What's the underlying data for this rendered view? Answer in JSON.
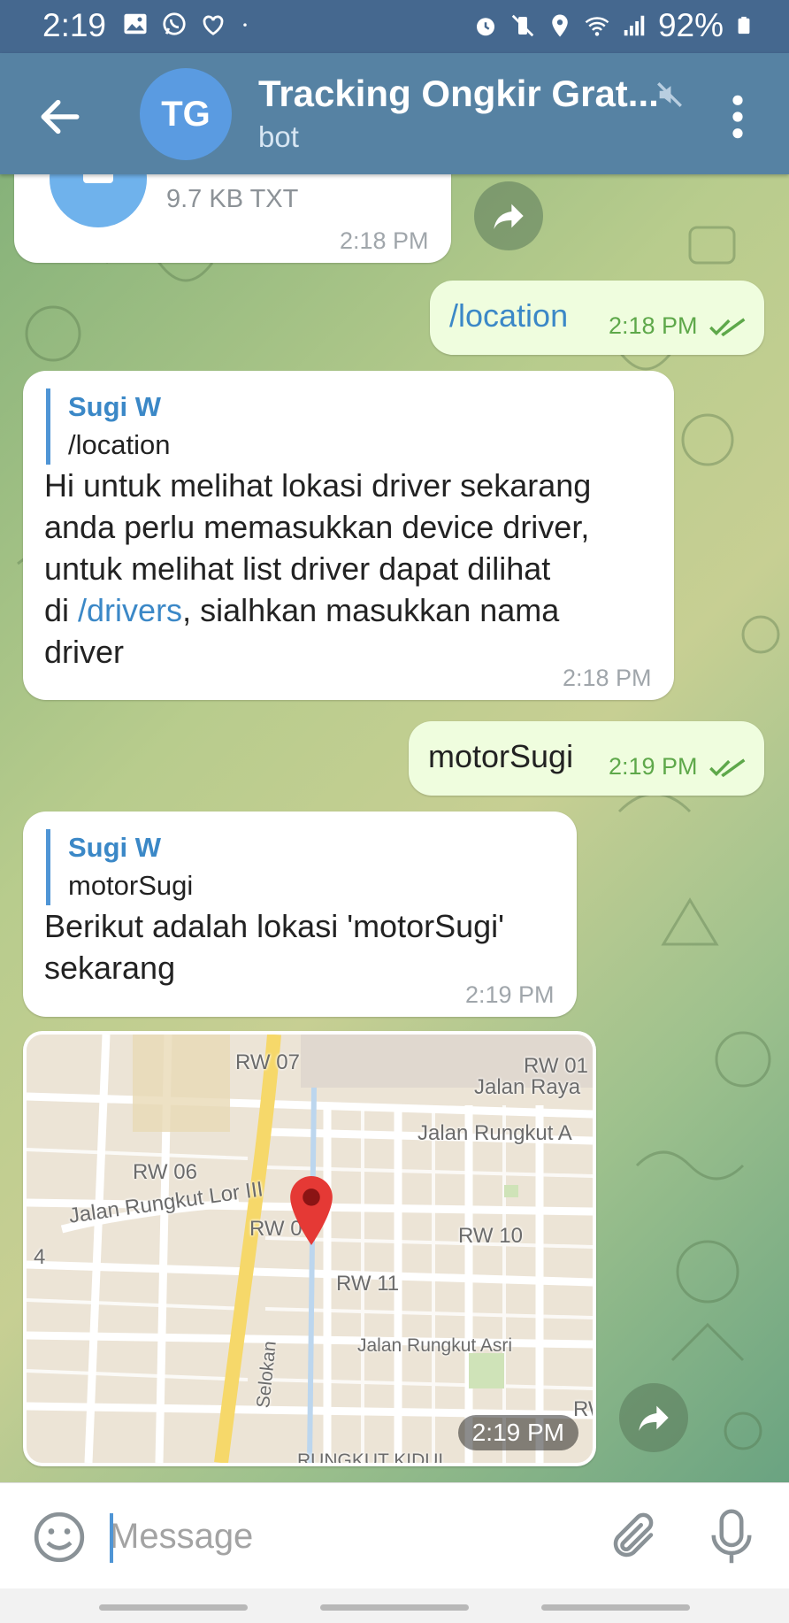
{
  "status_bar": {
    "time": "2:19",
    "battery": "92%"
  },
  "header": {
    "avatar_initials": "TG",
    "title": "Tracking Ongkir Grat...",
    "subtitle": "bot"
  },
  "messages": {
    "file": {
      "meta": "9.7 KB TXT",
      "time": "2:18 PM"
    },
    "out1": {
      "text": "/location",
      "time": "2:18 PM"
    },
    "in1": {
      "reply_name": "Sugi W",
      "reply_text": "/location",
      "line1": "Hi untuk melihat lokasi driver sekarang",
      "line2": "anda perlu memasukkan device driver,",
      "line3": "untuk melihat list driver dapat dilihat",
      "line4_pre": "di ",
      "line4_link": "/drivers",
      "line4_post": ", sialhkan masukkan nama",
      "line5": "driver",
      "time": "2:18 PM"
    },
    "out2": {
      "text": "motorSugi",
      "time": "2:19 PM"
    },
    "in2": {
      "reply_name": "Sugi W",
      "reply_text": "motorSugi",
      "line1": "Berikut adalah lokasi 'motorSugi'",
      "line2": "sekarang",
      "time": "2:19 PM"
    },
    "map": {
      "time": "2:19 PM",
      "labels": {
        "rw07": "RW 07",
        "rw01": "RW 01",
        "jalan_raya": "Jalan Raya",
        "jalan_rungkut_a": "Jalan Rungkut A",
        "rw06": "RW 06",
        "jalan_rungkut_lor": "Jalan Rungkut Lor III",
        "rw0": "RW 0",
        "rw10": "RW 10",
        "rw11": "RW 11",
        "four": "4",
        "jalan_rungkut_asri": "Jalan Rungkut Asri",
        "selokan": "Selokan",
        "rw_edge": "RW",
        "rungkut_kidul": "RUNGKUT KIDUL"
      }
    }
  },
  "input": {
    "placeholder": "Message",
    "value": ""
  },
  "colors": {
    "header": "#5682a3",
    "status_bar": "#45688f",
    "accent": "#4f95d5",
    "outgoing_bubble": "#effdde"
  }
}
